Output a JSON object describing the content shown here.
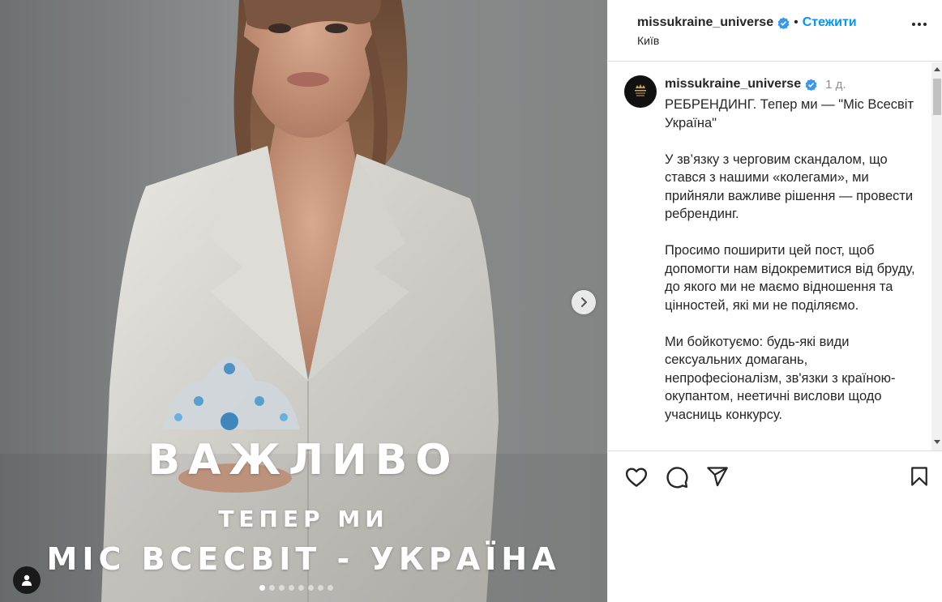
{
  "media": {
    "headline": "ВАЖЛИВО",
    "subheadline": "ТЕПЕР МИ",
    "title_line": "МІС ВСЕСВІТ - УКРАЇНА",
    "carousel": {
      "total": 8,
      "active_index": 0
    },
    "next_icon": "chevron-right-icon",
    "tag_icon": "user-icon"
  },
  "header": {
    "username": "missukraine_universe",
    "separator": "•",
    "follow_label": "Стежити",
    "location": "Київ",
    "more_icon": "more-horizontal-icon"
  },
  "caption": {
    "username": "missukraine_universe",
    "time": "1 д.",
    "text": "РЕБРЕНДИНГ. Тепер ми — \"Міс Всесвіт Україна\"\n\nУ зв’язку з черговим скандалом, що стався з нашими «колегами», ми прийняли важливе рішення — провести ребрендинг.\n\nПросимо поширити цей пост, щоб допомогти нам відокремитися від бруду, до якого ми не маємо відношення та цінностей, які ми не поділяємо.\n\nМи бойкотуємо: будь-які види сексуальних домагань, непрофесіоналізм, зв'язки з країною-окупантом, неетичні вислови щодо учасниць конкурсу."
  },
  "actions": {
    "like_icon": "heart-icon",
    "comment_icon": "comment-icon",
    "share_icon": "send-icon",
    "save_icon": "bookmark-icon"
  },
  "colors": {
    "accent": "#0095f6",
    "verified": "#3897f0",
    "text": "#262626",
    "muted": "#8e8e8e"
  }
}
